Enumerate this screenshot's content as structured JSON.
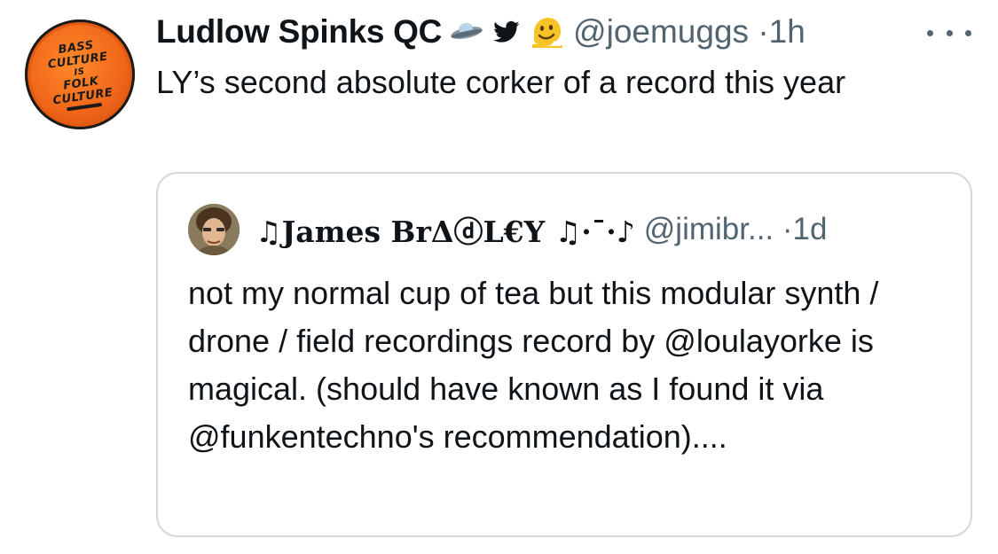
{
  "tweet": {
    "avatar_text": [
      "BASS",
      "CULTURE",
      "IS",
      "FOLK",
      "CULTURE"
    ],
    "display_name": "Ludlow Spinks QC",
    "emojis": [
      "ufo-icon",
      "twitter-bird-icon",
      "melting-face-icon"
    ],
    "handle": "@joemuggs",
    "separator": "·",
    "timestamp": "1h",
    "text": "LY’s second absolute corker of a record this year"
  },
  "quoted_tweet": {
    "display_name": "♫Jameѕ BrΔⓓL€Y ♫·¯·♪",
    "handle": "@jimibr...",
    "separator": "·",
    "timestamp": "1d",
    "text": "not my normal cup of tea but this modular synth / drone / field recordings record by @loulayorke is magical. (should have known as I found it via @funkentechno's recommendation)...."
  },
  "colors": {
    "text": "#0f1419",
    "secondary": "#536471",
    "border": "#cfd9de",
    "badge_orange": "#f0661a"
  }
}
